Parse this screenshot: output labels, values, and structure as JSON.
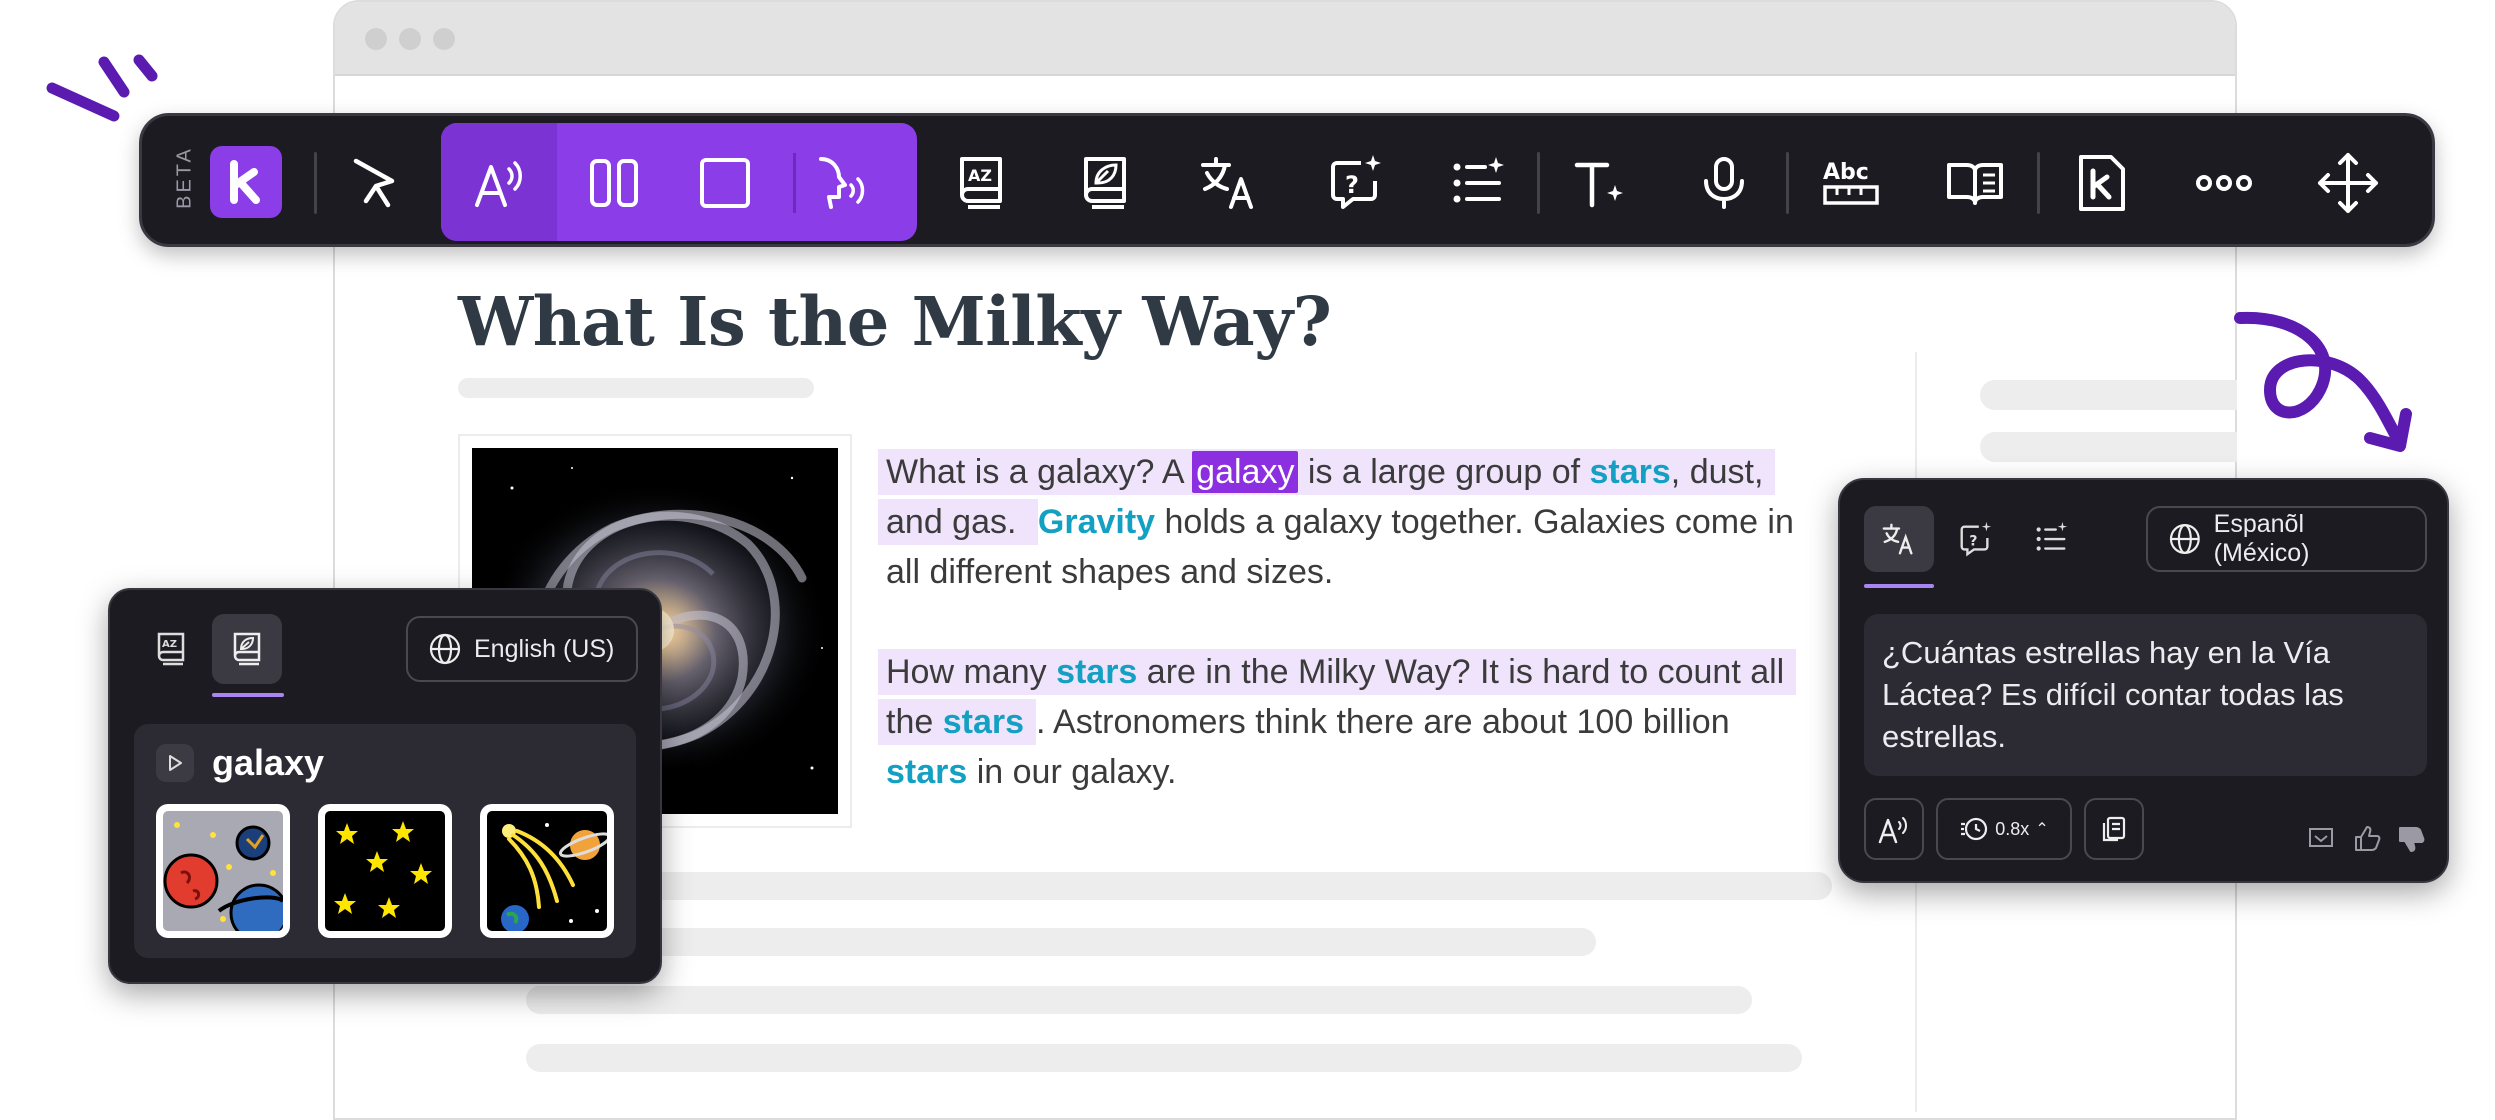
{
  "toolbar": {
    "beta_label": "BETA",
    "icons": [
      "kami-logo-icon",
      "select-cursor-icon",
      "read-aloud-icon",
      "column-layout-icon",
      "focus-box-icon",
      "speech-icon",
      "picture-dictionary-icon",
      "dictionary-icon",
      "translate-icon",
      "question-icon",
      "summary-icon",
      "add-text-icon",
      "microphone-icon",
      "spell-check-icon",
      "immersive-reader-icon",
      "kami-icon",
      "more-icon",
      "move-icon"
    ]
  },
  "article": {
    "title": "What Is the Milky Way?",
    "para1": {
      "l1_a": "What is a galaxy? A ",
      "l1_sel": "galaxy",
      "l1_b": " is a large group of ",
      "l1_kw": "stars",
      "l1_c": ", dust,",
      "l2_a": "and gas. ",
      "l2_kw": "Gravity",
      "l2_b": " holds a galaxy together. Galaxies come in",
      "l3": "all different shapes and sizes."
    },
    "para2": {
      "l1_a": "How many ",
      "l1_kw": "stars",
      "l1_b": " are in the Milky Way? It is hard to count all",
      "l2_a": "the ",
      "l2_kw": "stars",
      "l2_b": ". Astronomers think there are about 100 billion",
      "l3_kw": "stars",
      "l3_b": " in our galaxy."
    }
  },
  "dictionary_panel": {
    "language": "English (US)",
    "word": "galaxy",
    "images": [
      "planets-image",
      "stars-image",
      "comet-image"
    ]
  },
  "translate_panel": {
    "language": "Espanõl (México)",
    "text": "¿Cuántas estrellas hay en la Vía Láctea? Es difícil contar todas las estrellas.",
    "speed": "0.8x"
  },
  "colors": {
    "accent": "#8b3ee8",
    "keyword": "#14a0c2",
    "highlight": "#efe4fb",
    "toolbar_bg": "#1c1b22"
  }
}
